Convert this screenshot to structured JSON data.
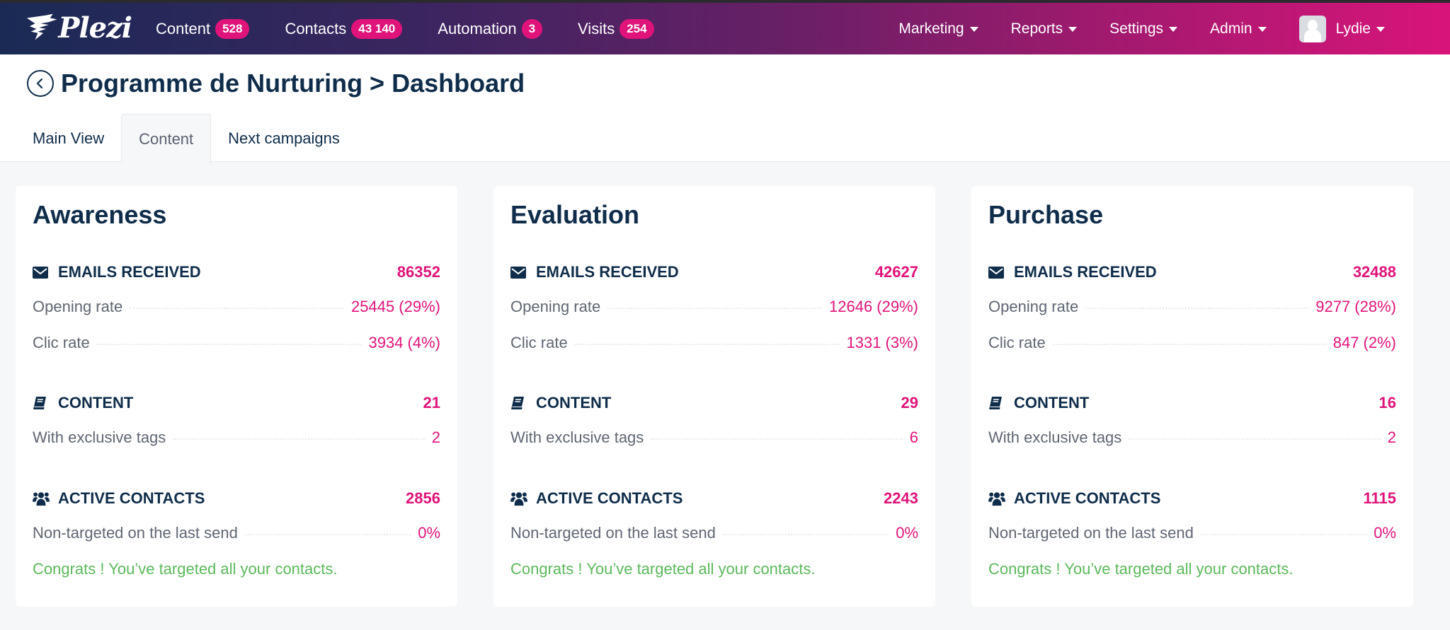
{
  "navbar": {
    "logo_text": "Plezi",
    "items": [
      {
        "label": "Content",
        "badge": "528"
      },
      {
        "label": "Contacts",
        "badge": "43 140"
      },
      {
        "label": "Automation",
        "badge": "3"
      },
      {
        "label": "Visits",
        "badge": "254"
      }
    ],
    "menus": [
      {
        "label": "Marketing"
      },
      {
        "label": "Reports"
      },
      {
        "label": "Settings"
      },
      {
        "label": "Admin"
      }
    ],
    "user": {
      "name": "Lydie"
    }
  },
  "header": {
    "title": "Programme de Nurturing > Dashboard",
    "tabs": [
      {
        "label": "Main View",
        "active": false
      },
      {
        "label": "Content",
        "active": true
      },
      {
        "label": "Next campaigns",
        "active": false
      }
    ]
  },
  "cards": [
    {
      "title": "Awareness",
      "emails": {
        "label": "EMAILS RECEIVED",
        "value": "86352",
        "rows": [
          {
            "label": "Opening rate",
            "value": "25445 (29%)"
          },
          {
            "label": "Clic rate",
            "value": "3934 (4%)"
          }
        ]
      },
      "content": {
        "label": "CONTENT",
        "value": "21",
        "rows": [
          {
            "label": "With exclusive tags",
            "value": "2"
          }
        ]
      },
      "contacts": {
        "label": "ACTIVE CONTACTS",
        "value": "2856",
        "rows": [
          {
            "label": "Non-targeted on the last send",
            "value": "0%"
          }
        ],
        "message": "Congrats ! You’ve targeted all your contacts."
      }
    },
    {
      "title": "Evaluation",
      "emails": {
        "label": "EMAILS RECEIVED",
        "value": "42627",
        "rows": [
          {
            "label": "Opening rate",
            "value": "12646 (29%)"
          },
          {
            "label": "Clic rate",
            "value": "1331 (3%)"
          }
        ]
      },
      "content": {
        "label": "CONTENT",
        "value": "29",
        "rows": [
          {
            "label": "With exclusive tags",
            "value": "6"
          }
        ]
      },
      "contacts": {
        "label": "ACTIVE CONTACTS",
        "value": "2243",
        "rows": [
          {
            "label": "Non-targeted on the last send",
            "value": "0%"
          }
        ],
        "message": "Congrats ! You’ve targeted all your contacts."
      }
    },
    {
      "title": "Purchase",
      "emails": {
        "label": "EMAILS RECEIVED",
        "value": "32488",
        "rows": [
          {
            "label": "Opening rate",
            "value": "9277 (28%)"
          },
          {
            "label": "Clic rate",
            "value": "847 (2%)"
          }
        ]
      },
      "content": {
        "label": "CONTENT",
        "value": "16",
        "rows": [
          {
            "label": "With exclusive tags",
            "value": "2"
          }
        ]
      },
      "contacts": {
        "label": "ACTIVE CONTACTS",
        "value": "1115",
        "rows": [
          {
            "label": "Non-targeted on the last send",
            "value": "0%"
          }
        ],
        "message": "Congrats ! You’ve targeted all your contacts."
      }
    }
  ],
  "colors": {
    "accent": "#e0137a",
    "primary": "#0f2d4a",
    "success": "#5cb85c"
  }
}
